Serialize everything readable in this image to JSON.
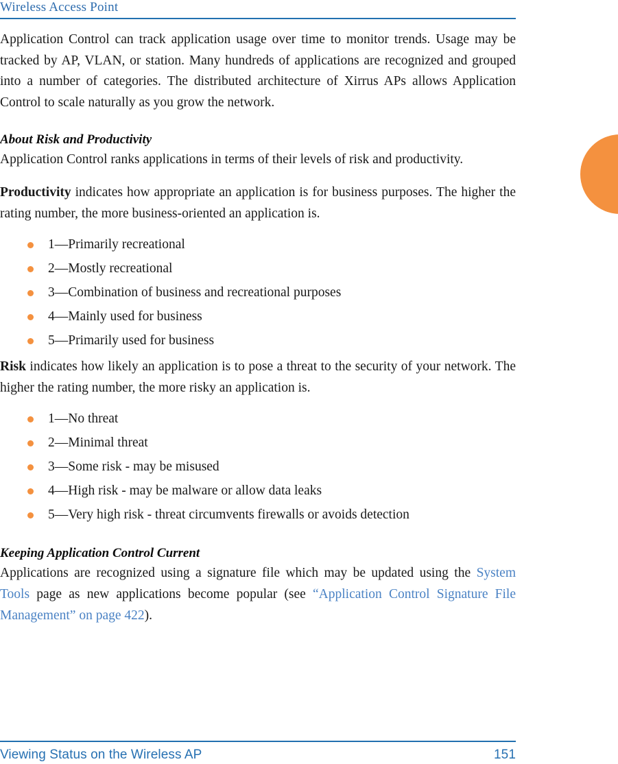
{
  "header": {
    "title": "Wireless Access Point"
  },
  "thumb_tab": {
    "color": "#f4913f"
  },
  "colors": {
    "header_blue": "#2d6cae",
    "rule_blue": "#2170b0",
    "link_blue": "#4a82c4",
    "bullet_orange": "#f4913f",
    "body_text": "#191919"
  },
  "body": {
    "intro_paragraph": "Application Control can track application usage over time to monitor trends. Usage may be tracked by AP, VLAN, or station. Many hundreds of applications are recognized and grouped into a number of categories. The distributed architecture of Xirrus APs allows Application Control to scale naturally as you grow the network.",
    "section_risk_productivity": {
      "heading": "About Risk and Productivity",
      "paragraph": "Application Control ranks applications in terms of their levels of risk and productivity.",
      "productivity": {
        "runin": "Productivity",
        "rest": " indicates how appropriate an application is for business purposes. The higher the rating number, the more business-oriented an application is.",
        "items": [
          "1—Primarily recreational",
          "2—Mostly recreational",
          "3—Combination of business and recreational purposes",
          "4—Mainly used for business",
          "5—Primarily used for business"
        ]
      },
      "risk": {
        "runin": "Risk",
        "rest": " indicates how likely an application is to pose a threat to the security of your network. The higher the rating number, the more risky an application is.",
        "items": [
          "1—No threat",
          "2—Minimal threat",
          "3—Some risk - may be misused",
          "4—High risk - may be malware or allow data leaks",
          "5—Very high risk - threat circumvents firewalls or avoids detection"
        ]
      }
    },
    "section_keeping_current": {
      "heading": "Keeping Application Control Current",
      "part1": "Applications are recognized using a signature file which may be updated using the ",
      "link_system_tools": "System Tools",
      "part2": " page as new applications become popular (see ",
      "link_xref": "“Application Control Signature File Management” on page 422",
      "part3": ")."
    }
  },
  "footer": {
    "text": "Viewing Status on the Wireless AP",
    "page_number": "151"
  }
}
